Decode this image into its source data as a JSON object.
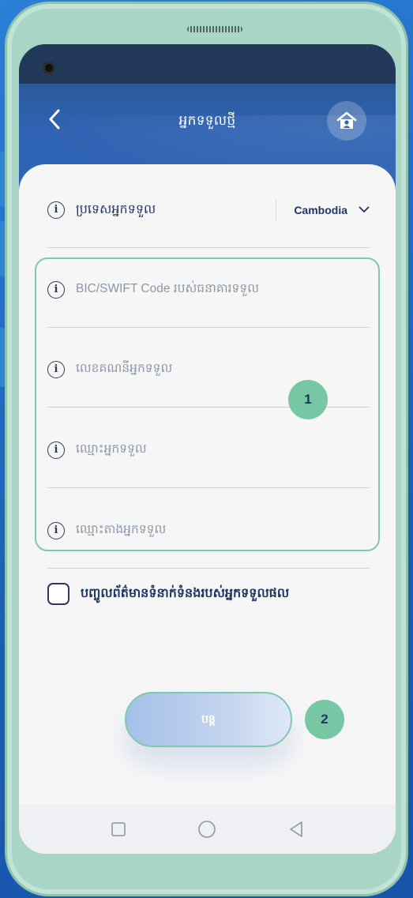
{
  "header": {
    "title": "អ្នកទទួលថ្មី"
  },
  "country_row": {
    "label": "ប្រទេសអ្នកទទួល",
    "selected": "Cambodia"
  },
  "fields": [
    {
      "label": "BIC/SWIFT Code របស់ធនាគារទទួល"
    },
    {
      "label": "លេខគណនីអ្នកទទួល"
    },
    {
      "label": "ឈ្មោះអ្នកទទួល"
    },
    {
      "label": "ឈ្មោះតាងអ្នកទទួល"
    }
  ],
  "checkbox": {
    "label": "បញ្ចូលព័ត៌មានទំនាក់ទំនងរបស់អ្នកទទួលផល",
    "checked": false
  },
  "continue_button": {
    "label": "បន្ត"
  },
  "badges": {
    "first": "1",
    "second": "2"
  },
  "colors": {
    "accent": "#2f63b3",
    "highlight": "#7ccaa9",
    "shell": "#a9d6c4"
  },
  "icons": [
    "back-icon",
    "home-icon",
    "info-icon",
    "chevron-down-icon",
    "nav-square-icon",
    "nav-circle-icon",
    "nav-triangle-icon"
  ]
}
